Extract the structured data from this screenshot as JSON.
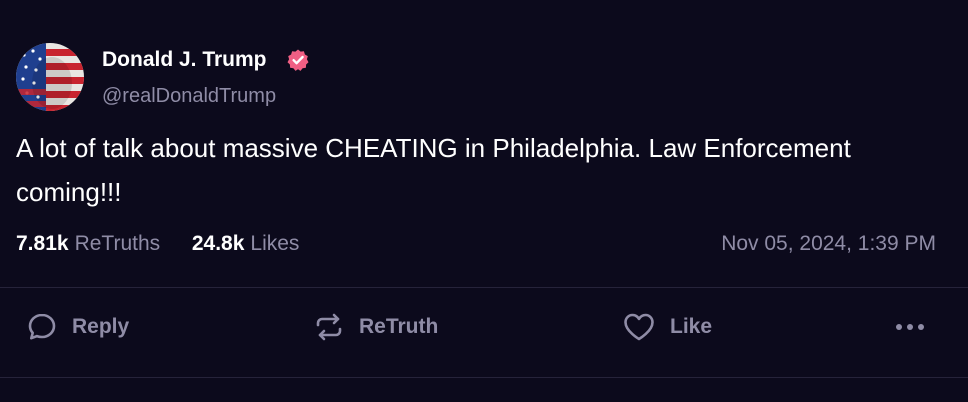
{
  "colors": {
    "background": "#0c0a1c",
    "text_primary": "#ffffff",
    "text_secondary": "#8f8ca6",
    "verified_badge": "#f05f84",
    "divider": "#26233a"
  },
  "author": {
    "display_name": "Donald J. Trump",
    "handle": "@realDonaldTrump",
    "verified": true,
    "avatar_icon": "flag-face-avatar",
    "verified_icon": "verified-check-icon"
  },
  "post": {
    "text": "A lot of talk about massive CHEATING in Philadelphia. Law Enforcement coming!!!"
  },
  "stats": {
    "retruths_count": "7.81k",
    "retruths_label": "ReTruths",
    "likes_count": "24.8k",
    "likes_label": "Likes",
    "timestamp": "Nov 05, 2024, 1:39 PM"
  },
  "actions": {
    "reply": {
      "label": "Reply",
      "icon": "speech-bubble-icon"
    },
    "retruth": {
      "label": "ReTruth",
      "icon": "retruth-arrows-icon"
    },
    "like": {
      "label": "Like",
      "icon": "heart-icon"
    },
    "more": {
      "icon": "more-dots-icon"
    }
  }
}
